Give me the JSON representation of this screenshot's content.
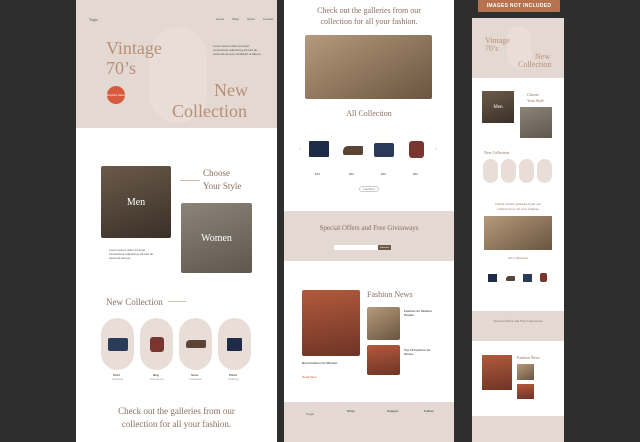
{
  "col1": {
    "logo": "Vogic",
    "nav": [
      "Home",
      "Shop",
      "About",
      "Contact"
    ],
    "hero_title_1": "Vintage",
    "hero_title_2": "70’s",
    "hero_title_3": "New",
    "hero_title_4": "Collection",
    "hero_btn": "Explore More",
    "hero_desc": "Lorem ipsum dolor sit amet consectetur adipiscing elit sed do eiusmod tempor incididunt ut labore",
    "choose_1": "Choose",
    "choose_2": "Your Style",
    "men": "Men",
    "women": "Women",
    "men_desc": "Lorem ipsum dolor sit amet consectetur adipiscing elit sed do eiusmod tempor",
    "new_collection": "New Collection",
    "items": [
      {
        "name": "Shirt",
        "sub": "Clothing"
      },
      {
        "name": "Bag",
        "sub": "Accessory"
      },
      {
        "name": "Shoe",
        "sub": "Footwear"
      },
      {
        "name": "Pants",
        "sub": "Clothing"
      }
    ],
    "gallery_1": "Check out the galleries from our",
    "gallery_2": "collection for all your fashion."
  },
  "col2": {
    "gallery_1": "Check out the galleries from our",
    "gallery_2": "collection for all your fashion.",
    "all_collection": "All Collection",
    "prices": [
      "$40",
      "$65",
      "$35",
      "$80"
    ],
    "load_more": "Load More",
    "offers": "Special Offers and Free Giveaways",
    "subscribe": "Subscribe",
    "fashion_news": "Fashion News",
    "news_1": "Best Fashion for Women",
    "news_2": "Fashion for Modern People",
    "news_3": "Top 10 Fashion for Stores",
    "read_more": "Read More",
    "footer_logo": "Vogic",
    "footer_heads": [
      "Shop",
      "Support",
      "Follow"
    ]
  },
  "col3": {
    "badge": "IMAGES NOT INCLUDED",
    "hero_1": "Vintage",
    "hero_2": "70’s",
    "hero_3": "New",
    "hero_4": "Collection",
    "choose_1": "Choose",
    "choose_2": "Your Style",
    "men": "Men",
    "new_collection": "New Collection",
    "gallery_1": "Check out the galleries from our",
    "gallery_2": "collection for all your fashion.",
    "all_collection": "All Collection",
    "offers": "Special Offers and Free Giveaways",
    "fashion_news": "Fashion News"
  },
  "colors": {
    "accent": "#d75a3c",
    "beige": "#e3d8d2",
    "bg": "#2e2e2e",
    "badge": "#b7724e"
  }
}
